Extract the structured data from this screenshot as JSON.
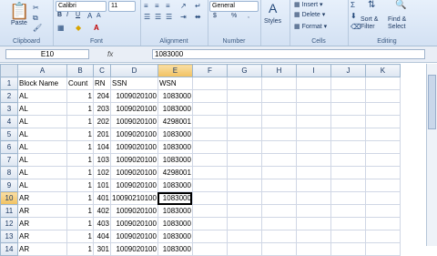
{
  "ribbon": {
    "clipboard": {
      "paste": "Paste",
      "label": "Clipboard"
    },
    "font": {
      "name": "Calibri",
      "size": "11",
      "label": "Font",
      "bold": "B",
      "italic": "I",
      "underline": "U"
    },
    "alignment": {
      "label": "Alignment"
    },
    "number": {
      "format": "General",
      "currency": "$",
      "percent": "%",
      "comma": ",",
      "label": "Number"
    },
    "styles": {
      "label": "Styles"
    },
    "cells": {
      "insert": "Insert",
      "delete": "Delete",
      "format": "Format",
      "label": "Cells"
    },
    "editing": {
      "sum": "Σ",
      "sort": "Sort &\nFilter",
      "find": "Find &\nSelect",
      "label": "Editing"
    }
  },
  "formula_bar": {
    "name_box": "E10",
    "fx": "fx",
    "value": "1083000"
  },
  "columns": [
    "A",
    "B",
    "C",
    "D",
    "E",
    "F",
    "G",
    "H",
    "I",
    "J",
    "K"
  ],
  "active_column": "E",
  "active_row": "10",
  "rows": [
    {
      "n": "1",
      "cells": [
        "Block Name",
        "Count",
        "RN",
        "SSN",
        "WSN"
      ]
    },
    {
      "n": "2",
      "cells": [
        "AL",
        "1",
        "204",
        "1009020100",
        "1083000"
      ]
    },
    {
      "n": "3",
      "cells": [
        "AL",
        "1",
        "203",
        "1009020100",
        "1083000"
      ]
    },
    {
      "n": "4",
      "cells": [
        "AL",
        "1",
        "202",
        "1009020100",
        "4298001"
      ]
    },
    {
      "n": "5",
      "cells": [
        "AL",
        "1",
        "201",
        "1009020100",
        "1083000"
      ]
    },
    {
      "n": "6",
      "cells": [
        "AL",
        "1",
        "104",
        "1009020100",
        "1083000"
      ]
    },
    {
      "n": "7",
      "cells": [
        "AL",
        "1",
        "103",
        "1009020100",
        "1083000"
      ]
    },
    {
      "n": "8",
      "cells": [
        "AL",
        "1",
        "102",
        "1009020100",
        "4298001"
      ]
    },
    {
      "n": "9",
      "cells": [
        "AL",
        "1",
        "101",
        "1009020100",
        "1083000"
      ]
    },
    {
      "n": "10",
      "cells": [
        "AR",
        "1",
        "401",
        "10090210100",
        "1083000"
      ]
    },
    {
      "n": "11",
      "cells": [
        "AR",
        "1",
        "402",
        "1009020100",
        "1083000"
      ]
    },
    {
      "n": "12",
      "cells": [
        "AR",
        "1",
        "403",
        "1009020100",
        "1083000"
      ]
    },
    {
      "n": "13",
      "cells": [
        "AR",
        "1",
        "404",
        "1009020100",
        "1083000"
      ]
    },
    {
      "n": "14",
      "cells": [
        "AR",
        "1",
        "301",
        "1009020100",
        "1083000"
      ]
    }
  ]
}
